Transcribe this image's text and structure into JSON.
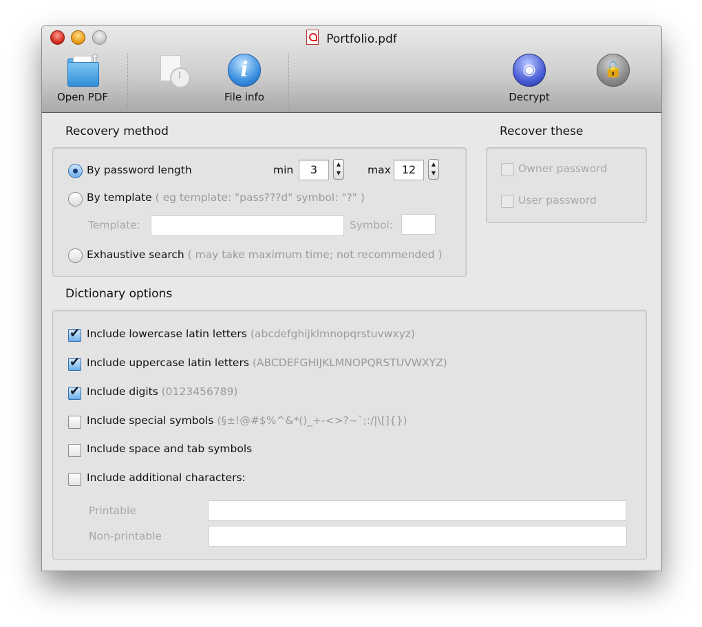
{
  "window": {
    "title": "Portfolio.pdf"
  },
  "toolbar": {
    "open_pdf": "Open PDF",
    "history": "History",
    "file_info": "File info",
    "decrypt": "Decrypt",
    "start_recovery": "Start recovery"
  },
  "recovery_method": {
    "heading": "Recovery method",
    "by_length": "By password length",
    "min_label": "min",
    "min_value": "3",
    "max_label": "max",
    "max_value": "12",
    "by_template": "By template",
    "template_hint": "( eg template: \"pass???d\" symbol: \"?\" )",
    "template_label": "Template:",
    "symbol_label": "Symbol:",
    "exhaustive": "Exhaustive search",
    "exhaustive_hint": "( may take maximum time; not recommended )",
    "selected": "By password length"
  },
  "recover_these": {
    "heading": "Recover these",
    "owner": "Owner password",
    "user": "User password"
  },
  "dictionary": {
    "heading": "Dictionary options",
    "items": [
      {
        "label": "Include lowercase latin letters",
        "hint": "(abcdefghijklmnopqrstuvwxyz)",
        "checked": true
      },
      {
        "label": "Include uppercase latin letters",
        "hint": "(ABCDEFGHIJKLMNOPQRSTUVWXYZ)",
        "checked": true
      },
      {
        "label": "Include digits",
        "hint": "(0123456789)",
        "checked": true
      },
      {
        "label": "Include special symbols",
        "hint": "(§±!@#$%^&*()_+-<>?~`;:/|\\[]{})",
        "checked": false
      },
      {
        "label": "Include space and tab symbols",
        "hint": "",
        "checked": false
      },
      {
        "label": "Include additional characters:",
        "hint": "",
        "checked": false
      }
    ],
    "printable_label": "Printable",
    "nonprintable_label": "Non-printable"
  },
  "icons": [
    "folder-upload-icon",
    "history-clock-icon",
    "info-icon",
    "decrypt-eye-icon",
    "unlock-icon"
  ]
}
